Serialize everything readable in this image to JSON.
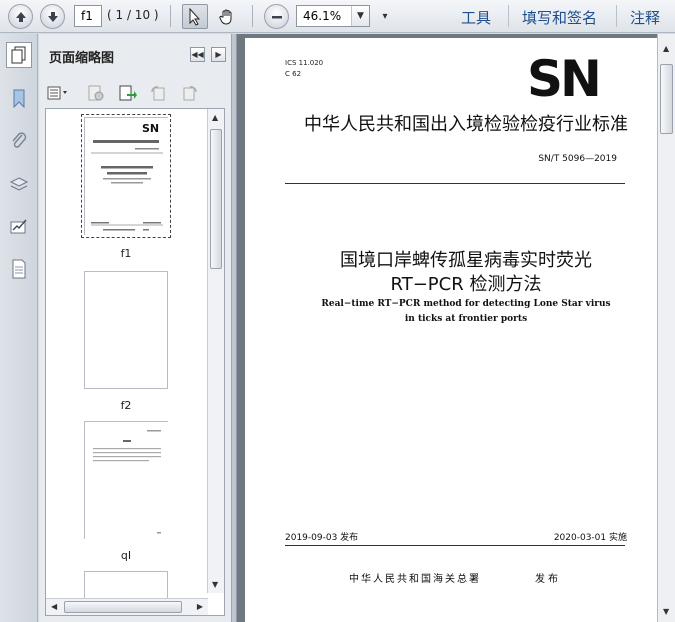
{
  "toolbar": {
    "page_value": "f1",
    "page_count": "( 1 / 10 )",
    "zoom_value": "46.1%",
    "links": [
      "工具",
      "填写和签名",
      "注释"
    ],
    "icons": [
      "page-up-icon",
      "page-down-icon",
      "select-cursor-icon",
      "hand-icon",
      "zoom-out-icon",
      "chevron-down-icon",
      "more-icon"
    ]
  },
  "sidebar": {
    "title": "页面缩略图",
    "rail_icons": [
      "bookmark-icon",
      "paperclip-icon",
      "layers-icon",
      "signature-icon",
      "page-icon"
    ],
    "tool_icons": [
      "options-icon",
      "delete-page-icon",
      "insert-page-icon",
      "rotate-left-icon",
      "rotate-right-icon"
    ],
    "thumbnails": [
      {
        "label": "f1",
        "selected": true
      },
      {
        "label": "f2",
        "selected": false
      },
      {
        "label": "qI",
        "selected": false
      }
    ]
  },
  "document": {
    "ics": "ICS 11.020",
    "ccs": "C 62",
    "logo": "SN",
    "category": "中华人民共和国出入境检验检疫行业标准",
    "std_no": "SN/T 5096—2019",
    "title_cn": "国境口岸蜱传孤星病毒实时荧光",
    "title_cn2": "RT−PCR 检测方法",
    "title_en1": "Real−time RT−PCR method for detecting Lone Star virus",
    "title_en2": "in ticks at frontier ports",
    "issue_date": "2019-09-03 发布",
    "impl_date": "2020-03-01 实施",
    "publisher": "中华人民共和国海关总署",
    "publish_word": "发布"
  },
  "colors": {
    "link": "#1f4e8c",
    "doc_bg": "#6f7781"
  }
}
